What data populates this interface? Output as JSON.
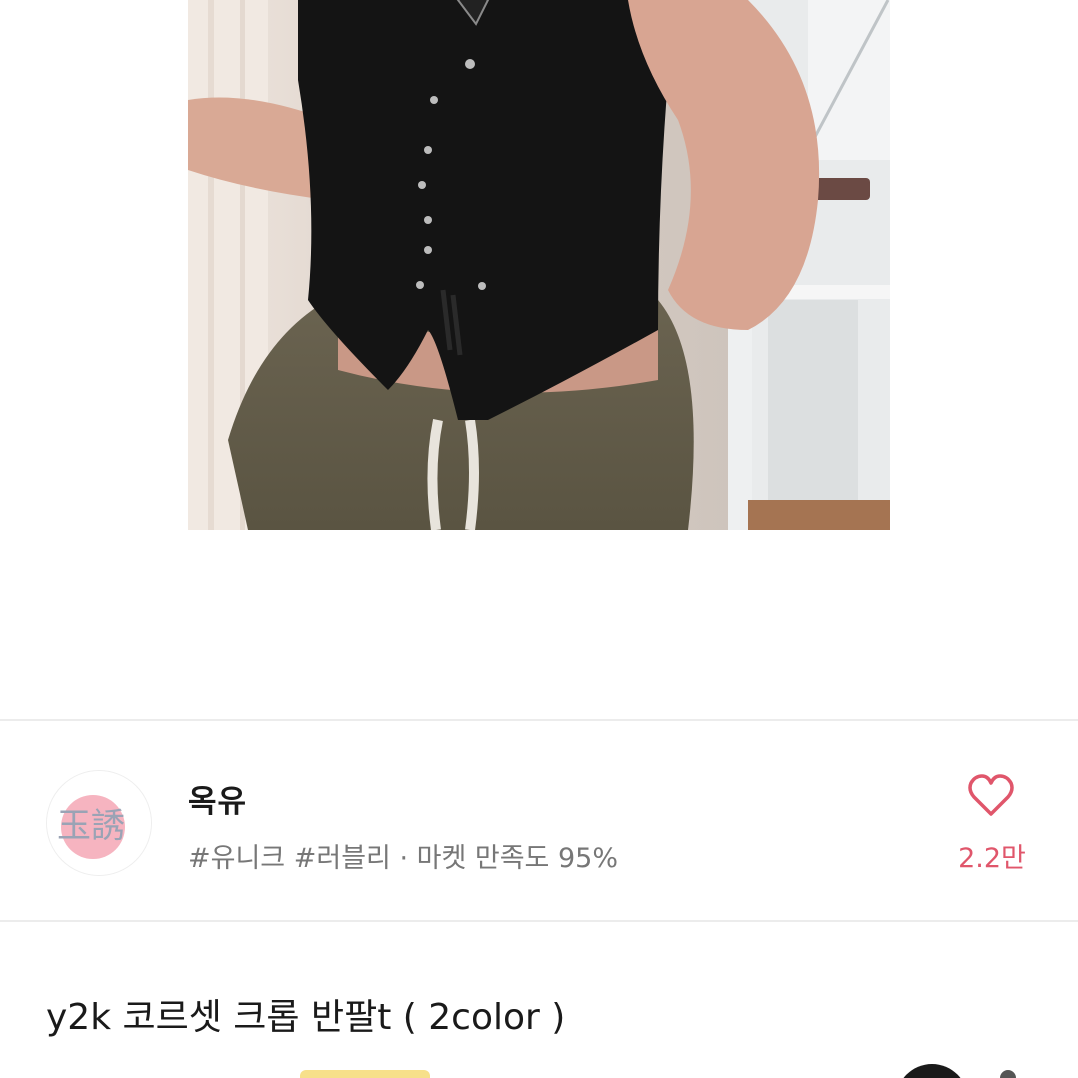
{
  "shop": {
    "name": "옥유",
    "meta": "#유니크 #러블리 · 마켓 만족도 95%",
    "logo_text": "玉誘",
    "favorite_count": "2.2만"
  },
  "product": {
    "title": "y2k 코르셋 크롭 반팔t ( 2color )"
  },
  "colors": {
    "accent": "#e0566b",
    "divider": "#ececec"
  },
  "icons": {
    "favorite": "heart-icon"
  }
}
